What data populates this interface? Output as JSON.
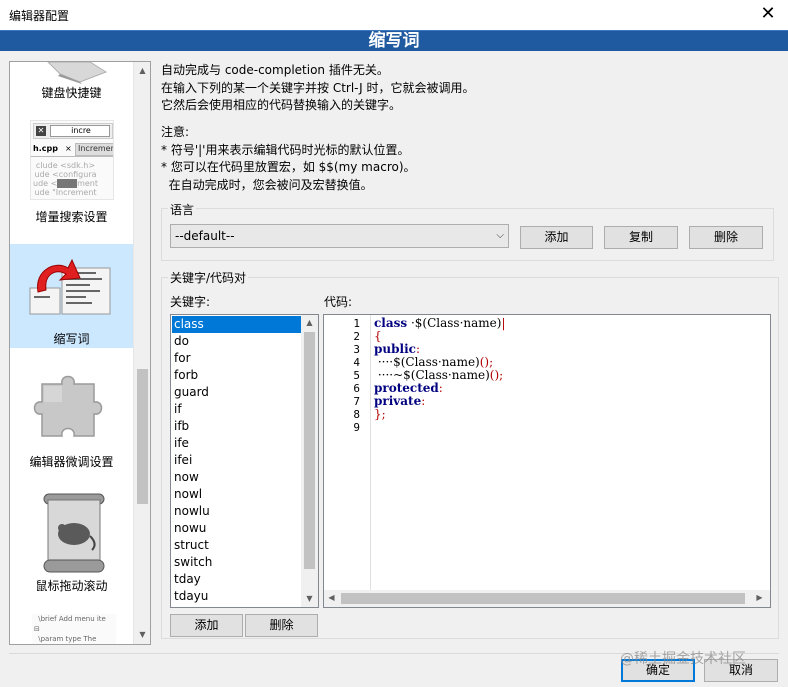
{
  "window": {
    "title": "编辑器配置",
    "close_glyph": "✕"
  },
  "banner": {
    "title": "缩写词"
  },
  "nav": {
    "items": [
      {
        "label": "键盘快捷键",
        "icon": "keyboard-icon"
      },
      {
        "label": "增量搜索设置",
        "icon": "incremental-search-icon",
        "preview_search": "incre",
        "preview_tab": "h.cpp",
        "preview_tab2": "Incremen"
      },
      {
        "label": "缩写词",
        "icon": "abbreviation-icon",
        "selected": true
      },
      {
        "label": "编辑器微调设置",
        "icon": "puzzle-icon"
      },
      {
        "label": "鼠标拖动滚动",
        "icon": "mouse-scroll-icon"
      },
      {
        "label": "",
        "icon": "doc-comment-icon",
        "preview_line1": "\\brief Add menu ite",
        "preview_line2": "\\param type The"
      }
    ]
  },
  "info": {
    "line1": "自动完成与 code-completion 插件无关。",
    "line2": "在输入下列的某一个关键字并按 Ctrl-J 时，它就会被调用。",
    "line3": "它然后会使用相应的代码替换输入的关键字。",
    "note_title": "注意:",
    "note1": "* 符号'|'用来表示编辑代码时光标的默认位置。",
    "note2": "* 您可以在代码里放置宏，如 $$(my macro)。",
    "note3": "  在自动完成时，您会被问及宏替换值。"
  },
  "language": {
    "group_title": "语言",
    "selected": "--default--",
    "add": "添加",
    "copy": "复制",
    "delete": "删除"
  },
  "keywords": {
    "group_title": "关键字/代码对",
    "keywords_label": "关键字:",
    "code_label": "代码:",
    "items": [
      "class",
      "do",
      "for",
      "forb",
      "guard",
      "if",
      "ifb",
      "ife",
      "ifei",
      "now",
      "nowl",
      "nowlu",
      "nowu",
      "struct",
      "switch",
      "tday",
      "tdayu"
    ],
    "selected_index": 0,
    "add": "添加",
    "delete": "删除"
  },
  "code": {
    "line_numbers": [
      "1",
      "2",
      "3",
      "4",
      "5",
      "6",
      "7",
      "8",
      "9"
    ]
  },
  "footer": {
    "ok": "确定",
    "cancel": "取消",
    "watermark": "@稀土掘金技术社区"
  }
}
